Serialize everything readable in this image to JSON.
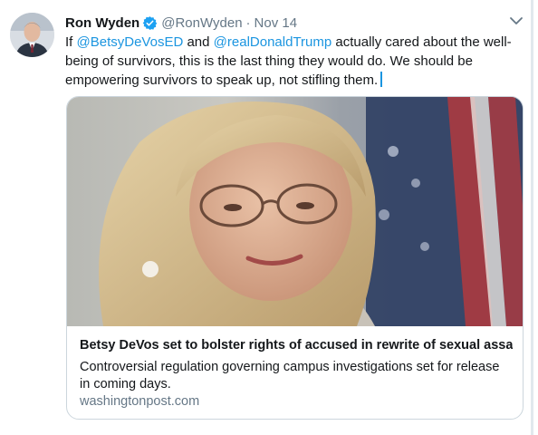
{
  "tweet": {
    "author_name": "Ron Wyden",
    "handle": "@RonWyden",
    "separator": "·",
    "timestamp": "Nov 14",
    "text_parts": [
      {
        "type": "text",
        "value": "If "
      },
      {
        "type": "mention",
        "value": "@BetsyDeVosED"
      },
      {
        "type": "text",
        "value": " and "
      },
      {
        "type": "mention",
        "value": "@realDonaldTrump"
      },
      {
        "type": "text",
        "value": " actually cared about the well-being of survivors, this is the last thing they would do. We should be empowering survivors to speak up, not stifling them."
      }
    ]
  },
  "card": {
    "title": "Betsy DeVos set to bolster rights of accused in rewrite of sexual assa…",
    "description": "Controversial regulation governing campus investigations set for release in coming days.",
    "domain": "washingtonpost.com"
  },
  "colors": {
    "link": "#1b95e0",
    "muted": "#657786",
    "verified": "#1da1f2",
    "border": "#ccd6dd"
  },
  "icons": {
    "verified": "verified-badge-icon",
    "caret": "chevron-down-icon"
  }
}
